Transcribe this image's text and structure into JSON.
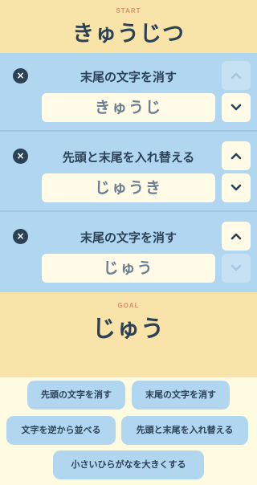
{
  "start": {
    "label": "START",
    "word": "きゅうじつ"
  },
  "steps": [
    {
      "operation": "末尾の文字を消す",
      "result": "きゅうじ",
      "remove_icon": "×",
      "up_enabled": false,
      "down_enabled": true
    },
    {
      "operation": "先頭と末尾を入れ替える",
      "result": "じゅうき",
      "remove_icon": "×",
      "up_enabled": true,
      "down_enabled": true
    },
    {
      "operation": "末尾の文字を消す",
      "result": "じゅう",
      "remove_icon": "×",
      "up_enabled": true,
      "down_enabled": false
    }
  ],
  "goal": {
    "label": "GOAL",
    "word": "じゅう"
  },
  "palette": {
    "operations": [
      "先頭の文字を消す",
      "末尾の文字を消す",
      "文字を逆から並べる",
      "先頭と末尾を入れ替える",
      "小さいひらがなを大きくする"
    ]
  },
  "icons": {
    "remove": "close-icon",
    "up": "chevron-up-icon",
    "down": "chevron-down-icon"
  },
  "colors": {
    "header_bg": "#f8e3a8",
    "steps_bg": "#b1d7f0",
    "palette_bg": "#fffbe0",
    "text": "#2a4156",
    "label_accent": "#d98f6a"
  }
}
